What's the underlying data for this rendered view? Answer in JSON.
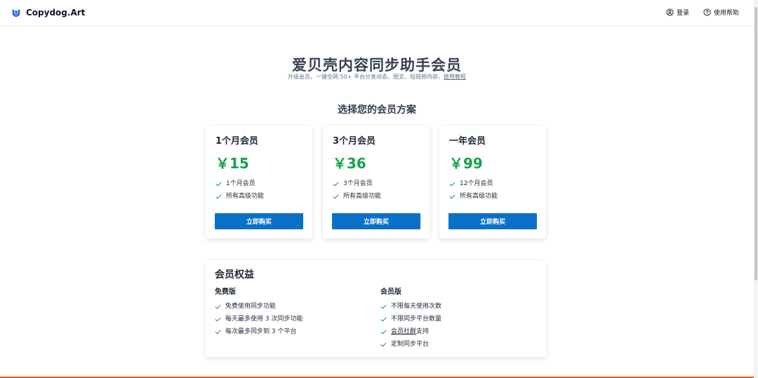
{
  "header": {
    "brand": "Copydog.Art",
    "login": "登录",
    "help": "使用帮助"
  },
  "hero": {
    "title": "爱贝壳内容同步助手会员",
    "subtitle_text": "升级会员，一键全网 50+ 平台分发动态、图文、短视频内容，",
    "subtitle_link": "使用教程"
  },
  "plans": {
    "section_title": "选择您的会员方案",
    "items": [
      {
        "name": "1个月会员",
        "price": "￥15",
        "features": [
          "1个月会员",
          "所有高级功能"
        ],
        "button": "立即购买"
      },
      {
        "name": "3个月会员",
        "price": "￥36",
        "features": [
          "3个月会员",
          "所有高级功能"
        ],
        "button": "立即购买"
      },
      {
        "name": "一年会员",
        "price": "￥99",
        "features": [
          "12个月会员",
          "所有高级功能"
        ],
        "button": "立即购买"
      }
    ]
  },
  "benefits": {
    "title": "会员权益",
    "free": {
      "title": "免费版",
      "items": [
        "免费使用同步功能",
        "每天最多使用 3 次同步功能",
        "每次最多同步到 3 个平台"
      ]
    },
    "member": {
      "title": "会员版",
      "items": [
        "不限每天使用次数",
        "不限同步平台数量",
        "会员社群",
        "支持",
        "定制同步平台"
      ]
    }
  },
  "colors": {
    "price": "#16a34a",
    "button": "#0b71c8",
    "check_member": "#16a34a",
    "check_free": "#6b7280",
    "footer_accent": "#ea580c"
  }
}
